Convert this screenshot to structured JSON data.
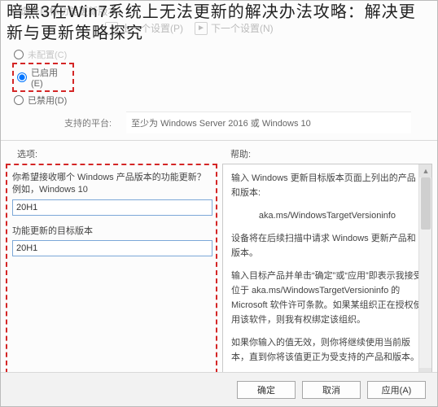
{
  "overlay_title": "暗黑3在Win7系统上无法更新的解决办法攻略：解决更新与更新策略探究",
  "top": {
    "policy_prefix": "选择目标功能更新版本"
  },
  "crumbs": {
    "prev": "上一个设置(P)",
    "next": "下一个设置(N)"
  },
  "radios": {
    "not_configured": "未配置(C)",
    "enabled": "已启用(E)",
    "disabled": "已禁用(D)"
  },
  "platform": {
    "label": "支持的平台:",
    "value": "至少为 Windows Server 2016 或 Windows 10"
  },
  "section_labels": {
    "options": "选项:",
    "help": "帮助:"
  },
  "options": {
    "question": "你希望接收哪个 Windows 产品版本的功能更新？例如，Windows 10",
    "value1": "20H1",
    "label2": "功能更新的目标版本",
    "value2": "20H1"
  },
  "help": {
    "p1": "输入 Windows 更新目标版本页面上列出的产品和版本:",
    "p2": "aka.ms/WindowsTargetVersioninfo",
    "p3": "设备将在后续扫描中请求 Windows 更新产品和版本。",
    "p4": "输入目标产品并单击“确定”或“应用”即表示我接受位于 aka.ms/WindowsTargetVersioninfo 的 Microsoft 软件许可条款。如果某组织正在授权使用该软件，则我有权绑定该组织。",
    "p5": "如果你输入的值无效，则你将继续使用当前版本，直到你将该值更正为受支持的产品和版本。"
  },
  "buttons": {
    "ok": "确定",
    "cancel": "取消",
    "apply": "应用(A)"
  }
}
